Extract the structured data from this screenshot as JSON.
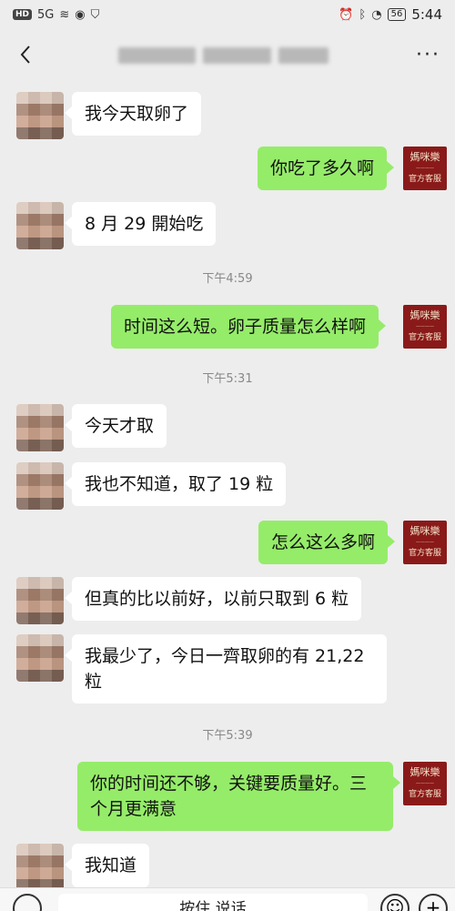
{
  "status_bar": {
    "hd": "HD",
    "signal": "5G",
    "battery": "56",
    "time": "5:44"
  },
  "nav": {
    "more": "···"
  },
  "official_avatar": {
    "brand": "媽咪樂",
    "tag": "官方客服"
  },
  "messages": [
    {
      "side": "left",
      "text": "我今天取卵了"
    },
    {
      "side": "right",
      "text": "你吃了多久啊"
    },
    {
      "side": "left",
      "text": "8 月 29 開始吃"
    },
    {
      "type": "time",
      "text": "下午4:59"
    },
    {
      "side": "right",
      "text": "时间这么短。卵子质量怎么样啊"
    },
    {
      "type": "time",
      "text": "下午5:31"
    },
    {
      "side": "left",
      "text": "今天才取"
    },
    {
      "side": "left",
      "text": "我也不知道，取了 19 粒"
    },
    {
      "side": "right",
      "text": "怎么这么多啊"
    },
    {
      "side": "left",
      "text": "但真的比以前好，以前只取到 6 粒"
    },
    {
      "side": "left",
      "text": "我最少了，今日一齊取卵的有 21,22 粒"
    },
    {
      "type": "time",
      "text": "下午5:39"
    },
    {
      "side": "right",
      "text": "你的时间还不够，关键要质量好。三个月更满意"
    },
    {
      "side": "left",
      "text": "我知道"
    }
  ],
  "input_bar": {
    "hold_talk": "按住 说话"
  }
}
